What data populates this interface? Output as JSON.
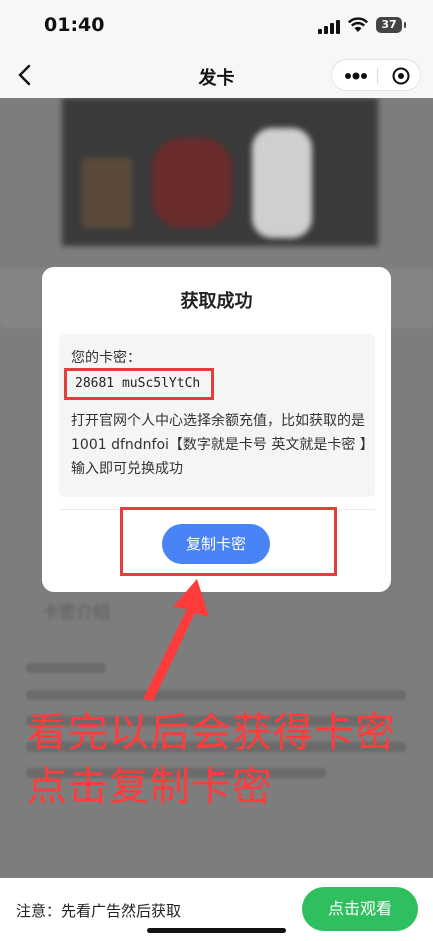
{
  "status_bar": {
    "time": "01:40",
    "battery": "37"
  },
  "nav": {
    "title": "发卡"
  },
  "dialog": {
    "title": "获取成功",
    "card_label": "您的卡密：",
    "card_code": "28681 muSc5lYtCh",
    "instructions": "打开官网个人中心选择余额充值，比如获取的是1001 dfndnfoi【数字就是卡号 英文就是卡密 】输入即可兑换成功",
    "copy_button": "复制卡密"
  },
  "background": {
    "blurred_text": "卡密介绍"
  },
  "annotation": {
    "line1": "看完以后会获得卡密",
    "line2": "点击复制卡密",
    "color": "#ff3b3b"
  },
  "bottom": {
    "note": "注意：先看广告然后获取",
    "watch_button": "点击观看"
  },
  "colors": {
    "copy_button": "#4a83f5",
    "watch_button": "#2fbf5e",
    "highlight": "#e53c3c"
  }
}
